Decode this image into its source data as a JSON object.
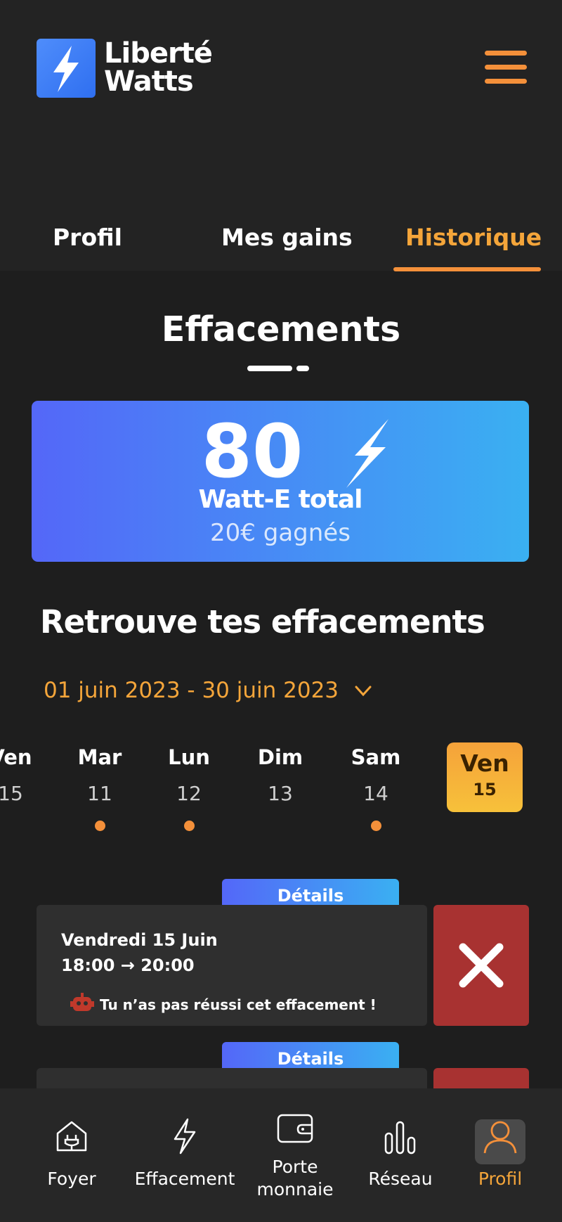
{
  "brand": {
    "name_line1": "Liberté",
    "name_line2": "Watts"
  },
  "tabs": [
    {
      "label": "Profil",
      "active": false
    },
    {
      "label": "Mes gains",
      "active": false
    },
    {
      "label": "Historique",
      "active": true
    }
  ],
  "section": {
    "title": "Effacements"
  },
  "total": {
    "value": "80",
    "label": "Watt-E total",
    "earned": "20€ gagnés"
  },
  "history": {
    "title": "Retrouve tes effacements",
    "date_range": "01 juin 2023 - 30 juin 2023",
    "days": [
      {
        "name": "Ven",
        "date": "15",
        "dot": false,
        "partial": true
      },
      {
        "name": "Mar",
        "date": "11",
        "dot": true
      },
      {
        "name": "Lun",
        "date": "12",
        "dot": true
      },
      {
        "name": "Dim",
        "date": "13",
        "dot": false
      },
      {
        "name": "Sam",
        "date": "14",
        "dot": true
      }
    ],
    "selected_day": {
      "name": "Ven",
      "date": "15"
    }
  },
  "events": [
    {
      "details_label": "Détails",
      "day": "Vendredi 15 Juin",
      "time": "18:00 → 20:00",
      "message": "Tu n’as pas réussi cet effacement !",
      "status": "failed"
    },
    {
      "details_label": "Détails",
      "status": "failed"
    }
  ],
  "bottom_nav": [
    {
      "label": "Foyer",
      "icon": "home-plug-icon"
    },
    {
      "label": "Effacement",
      "icon": "bolt-icon"
    },
    {
      "label": "Porte monnaie",
      "icon": "wallet-icon"
    },
    {
      "label": "Réseau",
      "icon": "bars-icon"
    },
    {
      "label": "Profil",
      "icon": "user-icon",
      "active": true
    }
  ],
  "colors": {
    "accent": "#f4903a",
    "gradient_start": "#5467f8",
    "gradient_end": "#3ab0f2",
    "fail": "#a83231"
  }
}
